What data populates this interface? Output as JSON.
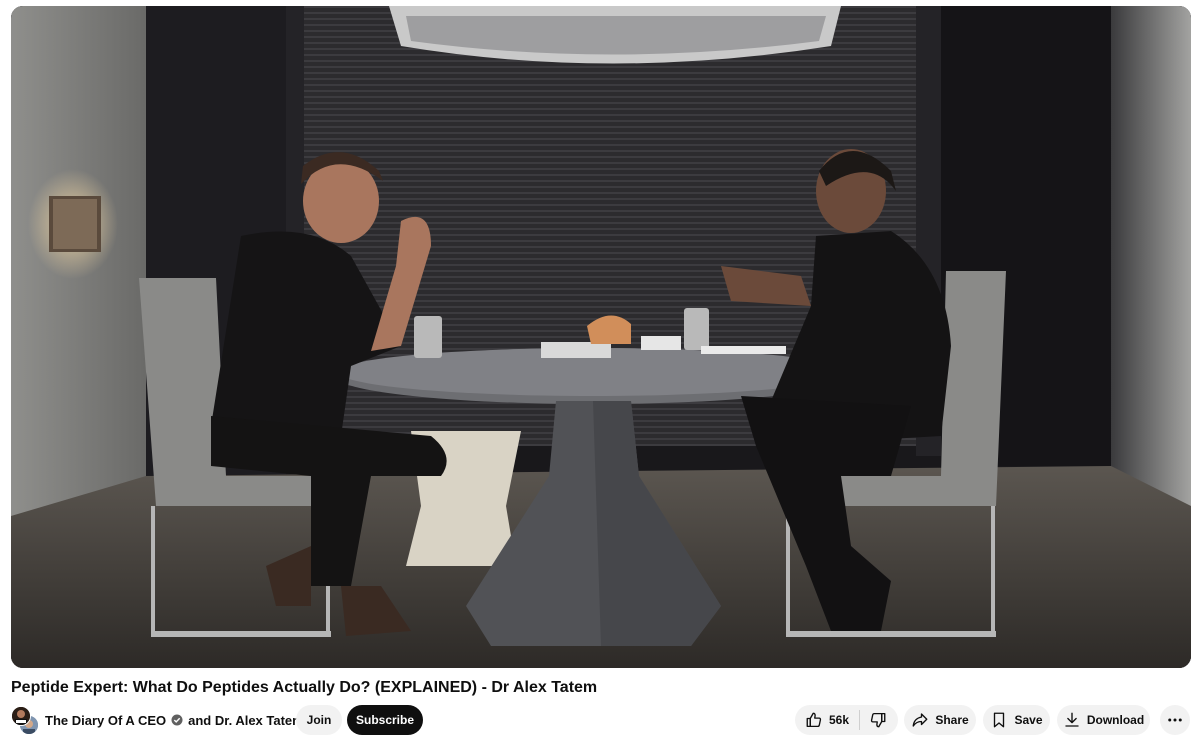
{
  "video": {
    "title": "Peptide Expert: What Do Peptides Actually Do? (EXPLAINED) - Dr Alex Tatem"
  },
  "owner": {
    "channel_name": "The Diary Of A CEO",
    "collaborator_text": "and Dr. Alex Tatem",
    "verified_icon": "check-circle-icon",
    "join_label": "Join",
    "subscribe_label": "Subscribe"
  },
  "actions": {
    "like_count": "56k",
    "like_icon": "thumbs-up-icon",
    "dislike_icon": "thumbs-down-icon",
    "share_label": "Share",
    "share_icon": "share-arrow-icon",
    "save_label": "Save",
    "save_icon": "bookmark-icon",
    "download_label": "Download",
    "download_icon": "download-icon",
    "more_icon": "more-horizontal-icon"
  },
  "colors": {
    "subscribe_bg": "#0f0f0f",
    "pill_bg": "#f2f2f2",
    "text": "#0f0f0f"
  }
}
